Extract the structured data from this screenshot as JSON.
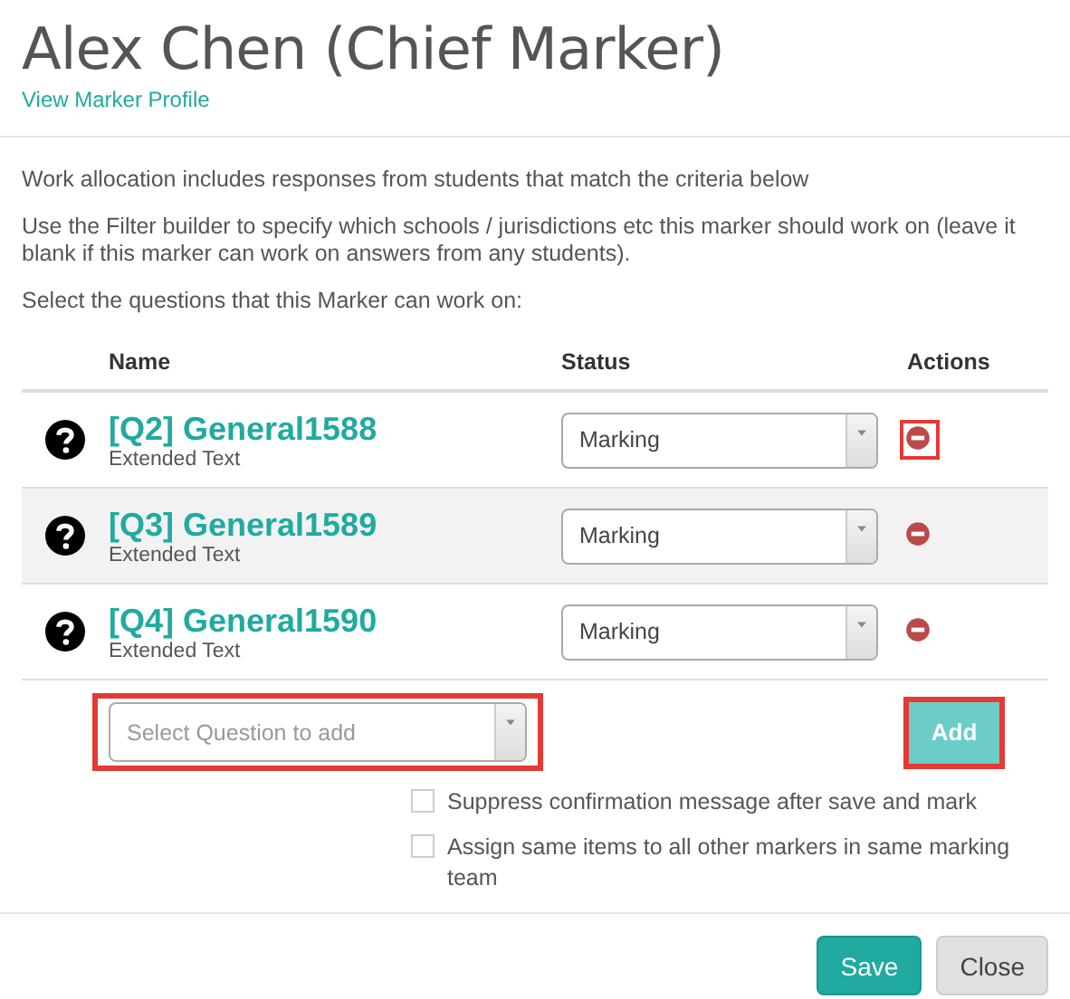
{
  "header": {
    "title": "Alex Chen (Chief Marker)",
    "profile_link": "View Marker Profile"
  },
  "paragraphs": [
    "Work allocation includes responses from students that match the criteria below",
    "Use the Filter builder to specify which schools / jurisdictions etc this marker should work on (leave it blank if this marker can work on answers from any students).",
    "Select the questions that this Marker can work on:"
  ],
  "table": {
    "columns": [
      "Name",
      "Status",
      "Actions"
    ],
    "rows": [
      {
        "name": "[Q2] General1588",
        "type": "Extended Text",
        "status": "Marking",
        "shaded": false,
        "remove_highlighted": true
      },
      {
        "name": "[Q3] General1589",
        "type": "Extended Text",
        "status": "Marking",
        "shaded": true,
        "remove_highlighted": false
      },
      {
        "name": "[Q4] General1590",
        "type": "Extended Text",
        "status": "Marking",
        "shaded": false,
        "remove_highlighted": false
      }
    ]
  },
  "add_question": {
    "placeholder": "Select Question to add",
    "highlighted": true,
    "button": "Add",
    "button_highlighted": true
  },
  "options": [
    {
      "label": "Suppress confirmation message after save and mark",
      "checked": false
    },
    {
      "label": "Assign same items to all other markers in same marking team",
      "checked": false
    }
  ],
  "buttons": [
    {
      "label": "Save",
      "kind": "primary"
    },
    {
      "label": "Close",
      "kind": "secondary"
    }
  ]
}
